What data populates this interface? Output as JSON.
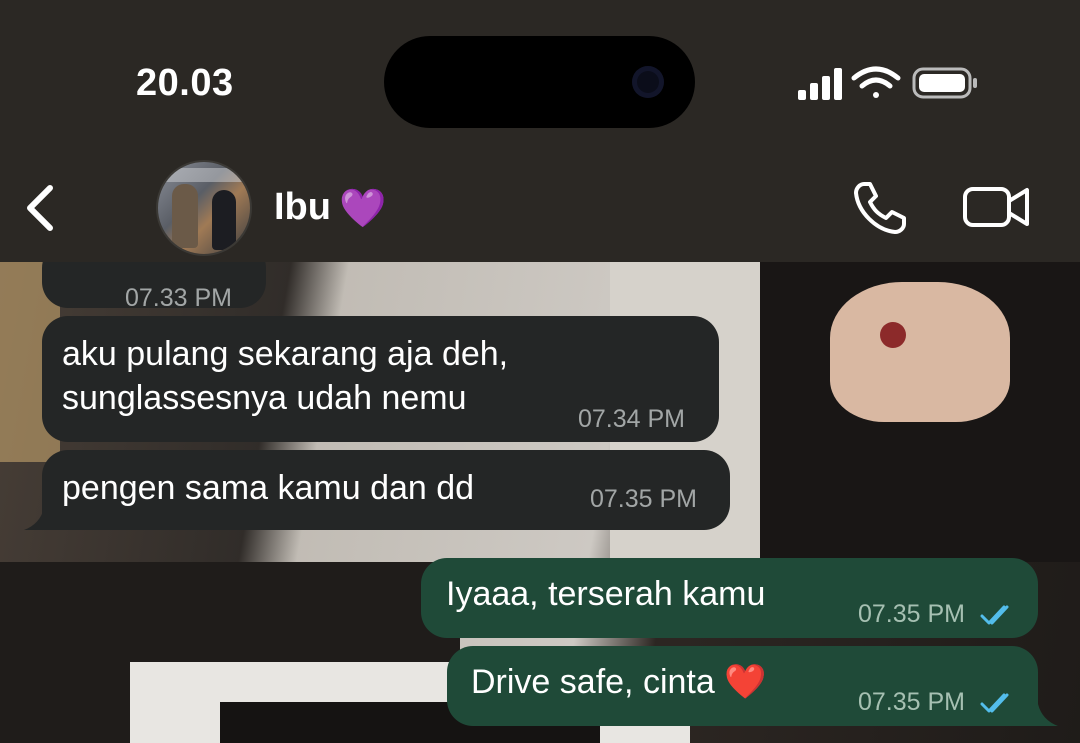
{
  "status_bar": {
    "time": "20.03",
    "icons": [
      "signal-icon",
      "wifi-icon",
      "battery-icon"
    ]
  },
  "header": {
    "contact_name": "Ibu",
    "contact_emoji": "💜",
    "icons": {
      "back": "back-chevron-icon",
      "call": "phone-icon",
      "video": "video-camera-icon"
    }
  },
  "colors": {
    "incoming_bubble": "#242626",
    "outgoing_bubble": "#1f4a38",
    "read_tick": "#53bdeb"
  },
  "messages": [
    {
      "direction": "in",
      "text": "",
      "time": "07.33 PM"
    },
    {
      "direction": "in",
      "text_line1": "aku pulang sekarang aja deh,",
      "text_line2": "sunglassesnya udah nemu",
      "time": "07.34 PM"
    },
    {
      "direction": "in",
      "text": "pengen sama kamu dan dd",
      "time": "07.35 PM"
    },
    {
      "direction": "out",
      "text": "Iyaaa, terserah kamu",
      "time": "07.35 PM",
      "status": "read"
    },
    {
      "direction": "out",
      "text": "Drive safe, cinta ❤️",
      "time": "07.35 PM",
      "status": "read"
    }
  ]
}
